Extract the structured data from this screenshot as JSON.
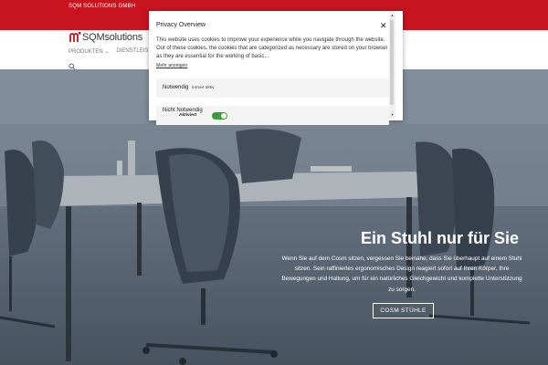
{
  "topbar": {
    "company": "SQM SOLUTIONS GMBH"
  },
  "brand": {
    "name": "SQMsolutions",
    "accent": "#c8141e"
  },
  "nav": {
    "items": [
      "PRODUKTEN ⌄",
      "DIENSTLEISTUN..."
    ]
  },
  "icons": {
    "search": "search-icon",
    "close": "close-icon",
    "logo": "sqm-logo-icon"
  },
  "hero": {
    "title": "Ein Stuhl nur für Sie",
    "text": "Wenn Sie auf dem Cosm sitzen, vergessen Sie beinahe, dass Sie überhaupt auf einem Stuhl sitzen. Sein raffiniertes ergonomisches Design reagiert sofort auf Ihren Körper, Ihre Bewegungen und Haltung, um für ein natürliches Gleichgewicht und komplette Unterstützung zu sorgen.",
    "button": "COSM STÜHLE"
  },
  "cookie_modal": {
    "title": "Privacy Overview",
    "close": "✕",
    "body": "This website uses cookies to improve your experience while you navigate through the website. Out of these cookies, the cookies that are categorized as necessary are stored on your browser as they are essential for the working of basic...",
    "link": "Mehr anzeigen",
    "rows": [
      {
        "label": "Notwendig",
        "status": "immer aktiv"
      },
      {
        "label": "Nicht Notwendig",
        "status": "Aktiviert",
        "toggle_on": true
      }
    ]
  }
}
